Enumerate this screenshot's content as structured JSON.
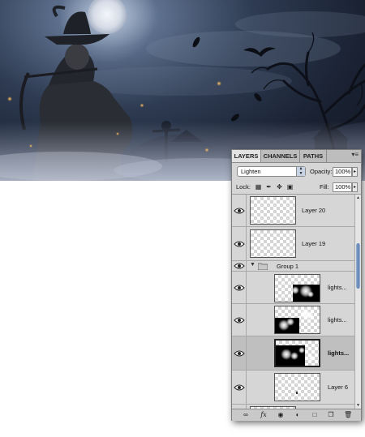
{
  "panel": {
    "tabs": [
      {
        "label": "LAYERS",
        "active": true
      },
      {
        "label": "CHANNELS",
        "active": false
      },
      {
        "label": "PATHS",
        "active": false
      }
    ],
    "menu_icon": "panel-menu-icon",
    "blend_mode": "Lighten",
    "opacity_label": "Opacity:",
    "opacity_value": "100%",
    "lock_label": "Lock:",
    "lock_icons": [
      "lock-transparency-icon",
      "lock-image-icon",
      "lock-position-icon",
      "lock-all-icon"
    ],
    "fill_label": "Fill:",
    "fill_value": "100%"
  },
  "layers": [
    {
      "name": "Layer 20",
      "type": "layer",
      "visible": true,
      "selected": false
    },
    {
      "name": "Layer 19",
      "type": "layer",
      "visible": true,
      "selected": false
    },
    {
      "name": "Group 1",
      "type": "group",
      "visible": true,
      "expanded": true
    },
    {
      "name": "lights...",
      "type": "layer",
      "visible": true,
      "selected": false
    },
    {
      "name": "lights...",
      "type": "layer",
      "visible": true,
      "selected": false
    },
    {
      "name": "lights...",
      "type": "layer",
      "visible": true,
      "selected": true
    },
    {
      "name": "Layer 6",
      "type": "layer",
      "visible": true,
      "selected": false
    }
  ],
  "footer_icons": [
    "link-layers-icon",
    "fx-icon",
    "add-mask-icon",
    "adjustment-layer-icon",
    "new-group-icon",
    "new-layer-icon",
    "trash-icon"
  ],
  "colors": {
    "panel_bg": "#d6d6d6",
    "selected_row": "#bfbfbf",
    "scroll_thumb": "#5a7fb3"
  }
}
